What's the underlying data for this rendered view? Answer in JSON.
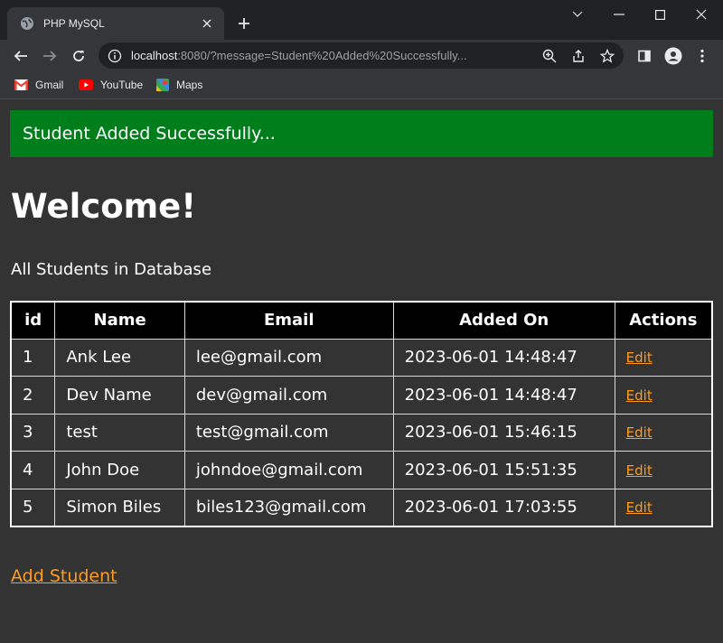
{
  "browser": {
    "tab_title": "PHP MySQL",
    "url_host": "localhost",
    "url_rest": ":8080/?message=Student%20Added%20Successfully...",
    "bookmarks": [
      {
        "label": "Gmail"
      },
      {
        "label": "YouTube"
      },
      {
        "label": "Maps"
      }
    ]
  },
  "page": {
    "alert": "Student Added Successfully...",
    "heading": "Welcome!",
    "subtitle": "All Students in Database",
    "table": {
      "headers": [
        "id",
        "Name",
        "Email",
        "Added On",
        "Actions"
      ],
      "rows": [
        {
          "id": "1",
          "name": "Ank Lee",
          "email": "lee@gmail.com",
          "added_on": "2023-06-01 14:48:47",
          "action": "Edit"
        },
        {
          "id": "2",
          "name": "Dev Name",
          "email": "dev@gmail.com",
          "added_on": "2023-06-01 14:48:47",
          "action": "Edit"
        },
        {
          "id": "3",
          "name": "test",
          "email": "test@gmail.com",
          "added_on": "2023-06-01 15:46:15",
          "action": "Edit"
        },
        {
          "id": "4",
          "name": "John Doe",
          "email": "johndoe@gmail.com",
          "added_on": "2023-06-01 15:51:35",
          "action": "Edit"
        },
        {
          "id": "5",
          "name": "Simon Biles",
          "email": "biles123@gmail.com",
          "added_on": "2023-06-01 17:03:55",
          "action": "Edit"
        }
      ]
    },
    "add_link": "Add Student"
  },
  "colors": {
    "alert_bg": "#007e1c",
    "link": "#ff9c1a",
    "page_bg": "#333333",
    "header_bg": "#000000"
  }
}
